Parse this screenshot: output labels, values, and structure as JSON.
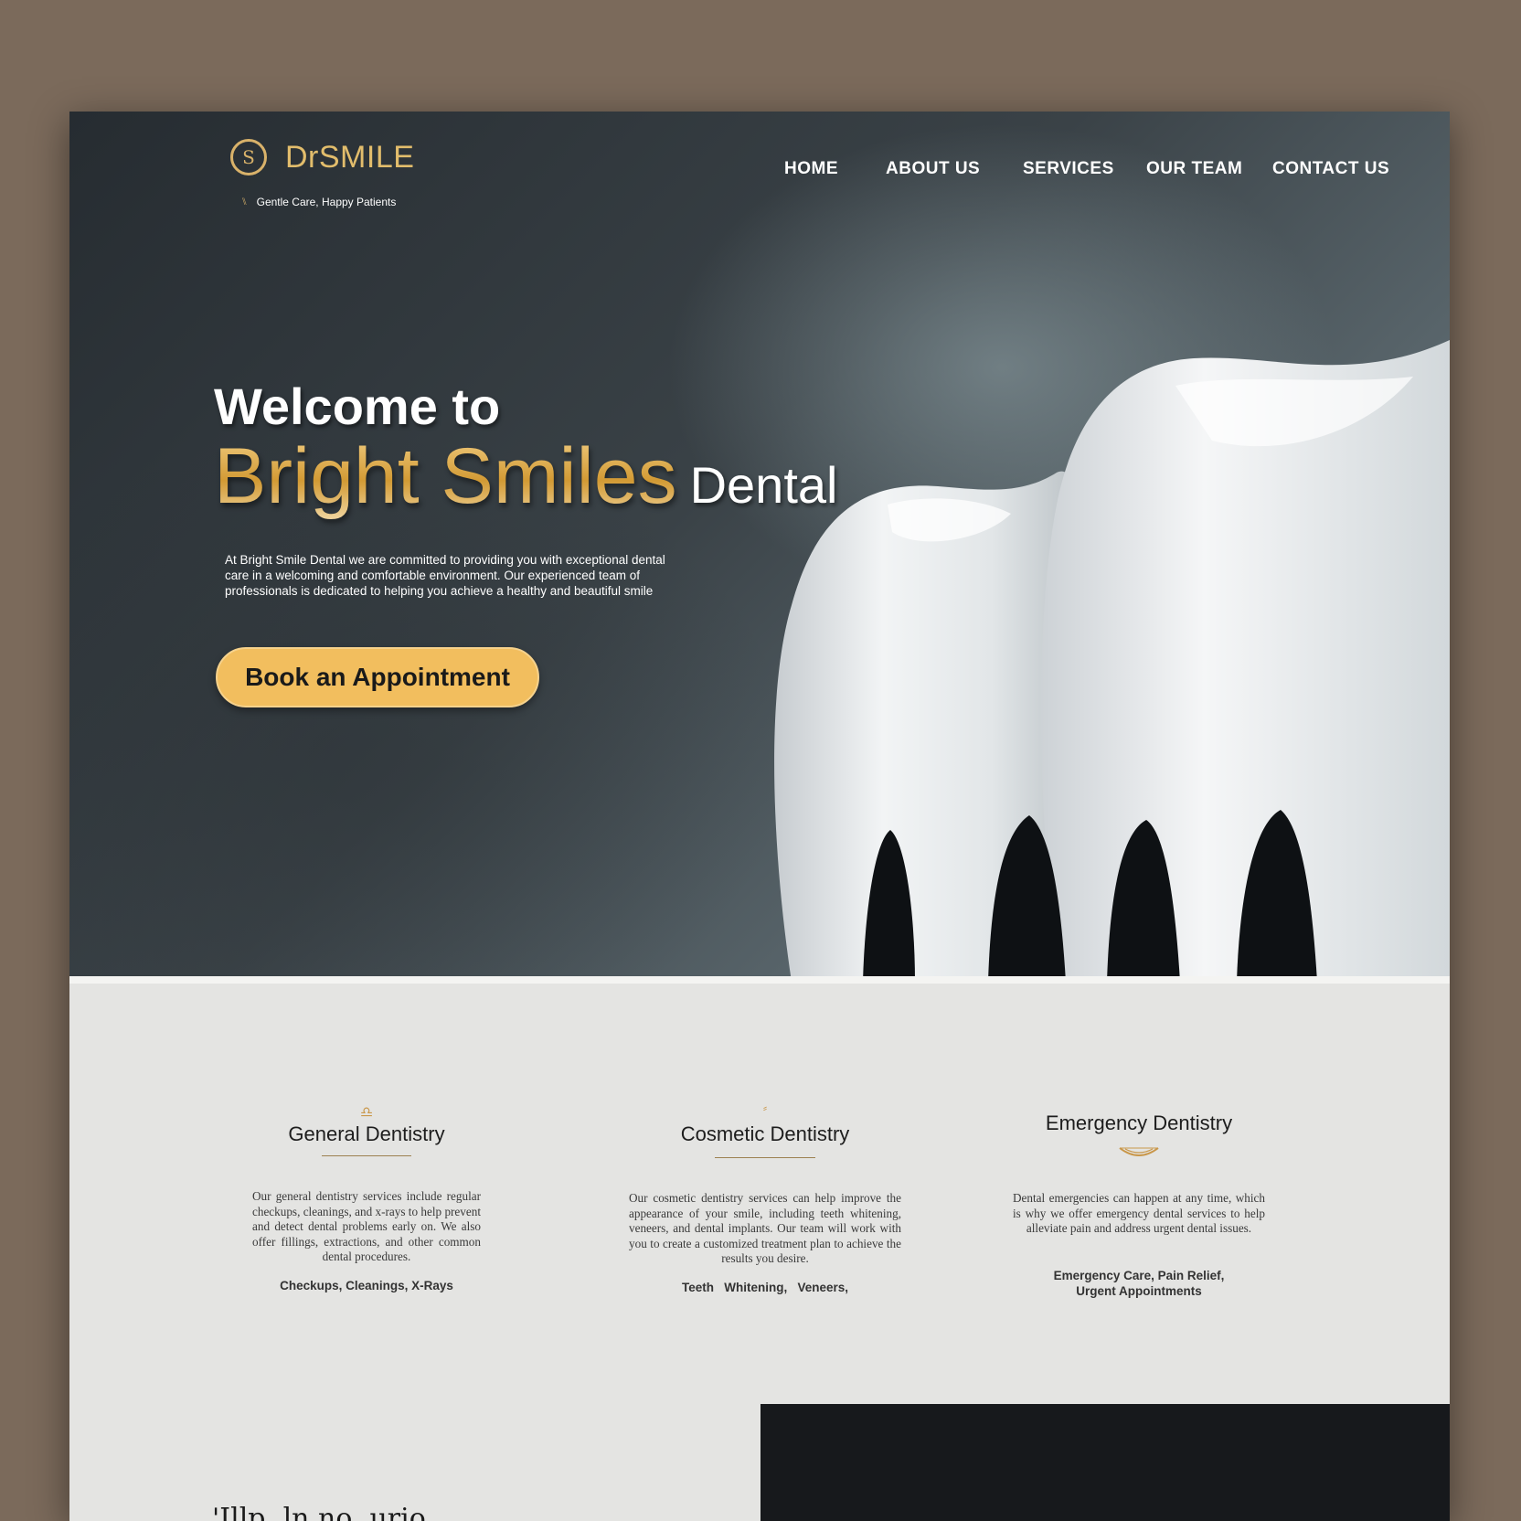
{
  "brand": {
    "logo_glyph": "S",
    "name": "DrSMILE",
    "tagline": "Gentle Care, Happy Patients"
  },
  "nav": {
    "items": [
      "HOME",
      "ABOUT US",
      "SERVICES",
      "OUR TEAM",
      "CONTACT US"
    ]
  },
  "hero": {
    "title_line1": "Welcome to",
    "title_highlight": "Bright Smiles",
    "title_suffix": "Dental",
    "description": "At Bright Smile Dental we are committed to providing you with exceptional dental care in a welcoming and comfortable environment. Our experienced team of professionals is dedicated to helping you achieve a healthy and beautiful smile",
    "cta_label": "Book an Appointment"
  },
  "services": [
    {
      "title": "General Dentistry",
      "icon": "tooth-outline-icon",
      "description": "Our general dentistry services include regular checkups, cleanings, and x-rays to help prevent and detect dental problems early on. We also offer fillings, extractions, and other common dental procedures.",
      "tags": "Checkups, Cleanings, X-Rays"
    },
    {
      "title": "Cosmetic Dentistry",
      "icon": "sparkle-icon",
      "description": "Our cosmetic dentistry services can help improve the appearance of your smile, including teeth whitening, veneers, and dental implants. Our team will work with you to create a customized treatment plan to achieve the results you desire.",
      "tags": "Teeth   Whitening,   Veneers,"
    },
    {
      "title": "Emergency Dentistry",
      "icon": "smile-icon",
      "description": "Dental emergencies can happen at any time, which is why we offer emergency dental services to help alleviate pain and address urgent dental issues.",
      "tags": "Emergency Care, Pain Relief, Urgent Appointments"
    }
  ],
  "bottom_heading": "'Illp, ln no, urio",
  "colors": {
    "gold": "#e0ae4d",
    "cta": "#f2be5e",
    "hero_dark": "#262c31",
    "section_bg": "#e4e4e2",
    "outer_bg": "#7b6a5b"
  }
}
